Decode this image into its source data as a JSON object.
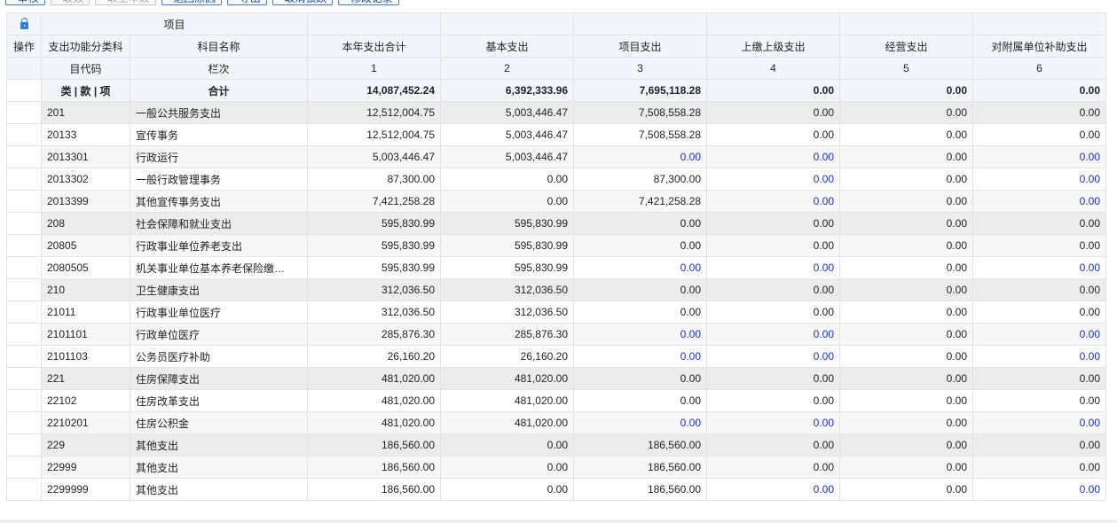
{
  "toolbar": {
    "buttons": [
      {
        "label": "审核",
        "icon": "check-icon",
        "enabled": true
      },
      {
        "label": "取数",
        "icon": "fetch-icon",
        "enabled": false
      },
      {
        "label": "取上年数",
        "icon": "fetch-last-year-icon",
        "enabled": false
      },
      {
        "label": "退回原因",
        "icon": "return-reason-icon",
        "enabled": true
      },
      {
        "label": "导出",
        "icon": "export-icon",
        "enabled": true
      },
      {
        "label": "取消锁跌",
        "icon": "cancel-lock-icon",
        "enabled": true
      },
      {
        "label": "修改记录",
        "icon": "history-icon",
        "enabled": true
      }
    ]
  },
  "header": {
    "lock_icon": "lock-icon",
    "operation": "操作",
    "project": "项目",
    "func_code_line1": "支出功能分类科",
    "func_code_line2": "目代码",
    "subject_name": "科目名称",
    "column_order": "栏次",
    "columns": [
      {
        "label": "本年支出合计",
        "num": "1"
      },
      {
        "label": "基本支出",
        "num": "2"
      },
      {
        "label": "项目支出",
        "num": "3"
      },
      {
        "label": "上缴上级支出",
        "num": "4"
      },
      {
        "label": "经营支出",
        "num": "5"
      },
      {
        "label": "对附属单位补助支出",
        "num": "6"
      }
    ]
  },
  "total_row": {
    "code": "类 | 款 | 项",
    "name": "合计",
    "values": [
      "14,087,452.24",
      "6,392,333.96",
      "7,695,118.28",
      "0.00",
      "0.00",
      "0.00"
    ]
  },
  "rows": [
    {
      "code": "201",
      "name": "一般公共服务支出",
      "level": 1,
      "values": [
        "12,512,004.75",
        "5,003,446.47",
        "7,508,558.28",
        "0.00",
        "0.00",
        "0.00"
      ]
    },
    {
      "code": "20133",
      "name": "宣传事务",
      "level": 2,
      "values": [
        "12,512,004.75",
        "5,003,446.47",
        "7,508,558.28",
        "0.00",
        "0.00",
        "0.00"
      ]
    },
    {
      "code": "2013301",
      "name": "行政运行",
      "level": 3,
      "values": [
        "5,003,446.47",
        "5,003,446.47",
        "0.00",
        "0.00",
        "0.00",
        "0.00"
      ]
    },
    {
      "code": "2013302",
      "name": "一般行政管理事务",
      "level": 3,
      "values": [
        "87,300.00",
        "0.00",
        "87,300.00",
        "0.00",
        "0.00",
        "0.00"
      ]
    },
    {
      "code": "2013399",
      "name": "其他宣传事务支出",
      "level": 3,
      "values": [
        "7,421,258.28",
        "0.00",
        "7,421,258.28",
        "0.00",
        "0.00",
        "0.00"
      ]
    },
    {
      "code": "208",
      "name": "社会保障和就业支出",
      "level": 1,
      "values": [
        "595,830.99",
        "595,830.99",
        "0.00",
        "0.00",
        "0.00",
        "0.00"
      ]
    },
    {
      "code": "20805",
      "name": "行政事业单位养老支出",
      "level": 2,
      "values": [
        "595,830.99",
        "595,830.99",
        "0.00",
        "0.00",
        "0.00",
        "0.00"
      ]
    },
    {
      "code": "2080505",
      "name": "机关事业单位基本养老保险缴…",
      "level": 3,
      "values": [
        "595,830.99",
        "595,830.99",
        "0.00",
        "0.00",
        "0.00",
        "0.00"
      ]
    },
    {
      "code": "210",
      "name": "卫生健康支出",
      "level": 1,
      "values": [
        "312,036.50",
        "312,036.50",
        "0.00",
        "0.00",
        "0.00",
        "0.00"
      ]
    },
    {
      "code": "21011",
      "name": "行政事业单位医疗",
      "level": 2,
      "values": [
        "312,036.50",
        "312,036.50",
        "0.00",
        "0.00",
        "0.00",
        "0.00"
      ]
    },
    {
      "code": "2101101",
      "name": "行政单位医疗",
      "level": 3,
      "values": [
        "285,876.30",
        "285,876.30",
        "0.00",
        "0.00",
        "0.00",
        "0.00"
      ]
    },
    {
      "code": "2101103",
      "name": "公务员医疗补助",
      "level": 3,
      "values": [
        "26,160.20",
        "26,160.20",
        "0.00",
        "0.00",
        "0.00",
        "0.00"
      ]
    },
    {
      "code": "221",
      "name": "住房保障支出",
      "level": 1,
      "values": [
        "481,020.00",
        "481,020.00",
        "0.00",
        "0.00",
        "0.00",
        "0.00"
      ]
    },
    {
      "code": "22102",
      "name": "住房改革支出",
      "level": 2,
      "values": [
        "481,020.00",
        "481,020.00",
        "0.00",
        "0.00",
        "0.00",
        "0.00"
      ]
    },
    {
      "code": "2210201",
      "name": "住房公积金",
      "level": 3,
      "values": [
        "481,020.00",
        "481,020.00",
        "0.00",
        "0.00",
        "0.00",
        "0.00"
      ]
    },
    {
      "code": "229",
      "name": "其他支出",
      "level": 1,
      "values": [
        "186,560.00",
        "0.00",
        "186,560.00",
        "0.00",
        "0.00",
        "0.00"
      ]
    },
    {
      "code": "22999",
      "name": "其他支出",
      "level": 2,
      "values": [
        "186,560.00",
        "0.00",
        "186,560.00",
        "0.00",
        "0.00",
        "0.00"
      ]
    },
    {
      "code": "2299999",
      "name": "其他支出",
      "level": 3,
      "values": [
        "186,560.00",
        "0.00",
        "186,560.00",
        "0.00",
        "0.00",
        "0.00"
      ]
    }
  ],
  "colors": {
    "editable_value": "#1a2fd0",
    "level1_row": "#ececec",
    "header_bg": "#f2f6fb"
  }
}
